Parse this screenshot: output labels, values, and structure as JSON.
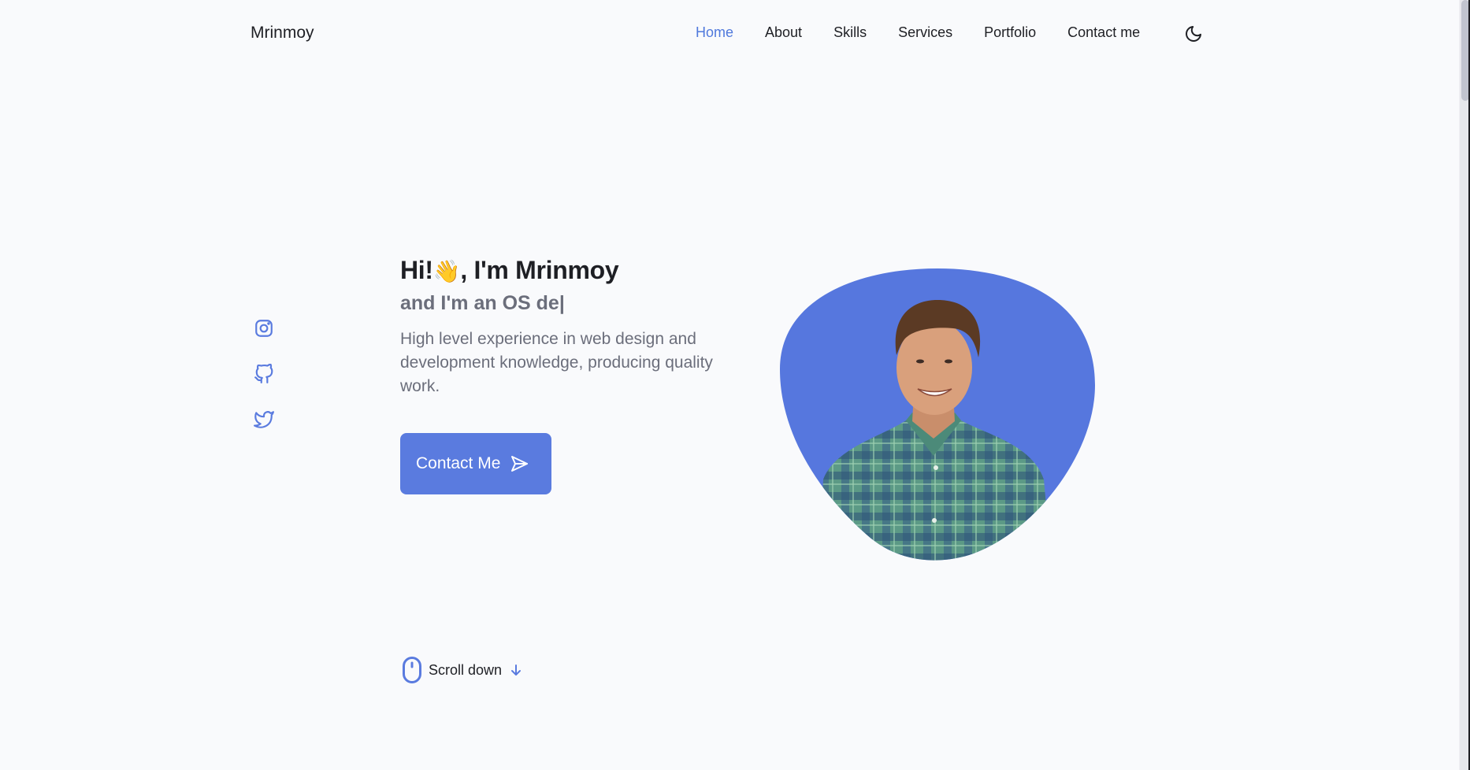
{
  "header": {
    "logo": "Mrinmoy",
    "nav": [
      {
        "label": "Home",
        "active": true
      },
      {
        "label": "About",
        "active": false
      },
      {
        "label": "Skills",
        "active": false
      },
      {
        "label": "Services",
        "active": false
      },
      {
        "label": "Portfolio",
        "active": false
      },
      {
        "label": "Contact me",
        "active": false
      }
    ],
    "theme_toggle_icon": "moon-icon"
  },
  "socials": [
    {
      "name": "instagram",
      "icon": "instagram-icon"
    },
    {
      "name": "github",
      "icon": "github-icon"
    },
    {
      "name": "twitter",
      "icon": "twitter-icon"
    }
  ],
  "hero": {
    "greeting_prefix": "Hi!",
    "wave_emoji": "👋",
    "greeting_suffix": ", I'm Mrinmoy",
    "typed_subtitle": "and I'm an OS de",
    "cursor": "|",
    "description": "High level experience in web design and development knowledge, producing quality work.",
    "cta_label": "Contact Me",
    "cta_icon": "send-icon",
    "photo_alt": "Smiling man in a green plaid shirt"
  },
  "scroll": {
    "label": "Scroll down",
    "mouse_icon": "mouse-icon",
    "arrow_icon": "arrow-down-icon"
  },
  "colors": {
    "accent": "#5a7bdf",
    "text": "#1e1f24",
    "muted": "#6b6e7b",
    "background": "#f9fafc"
  }
}
